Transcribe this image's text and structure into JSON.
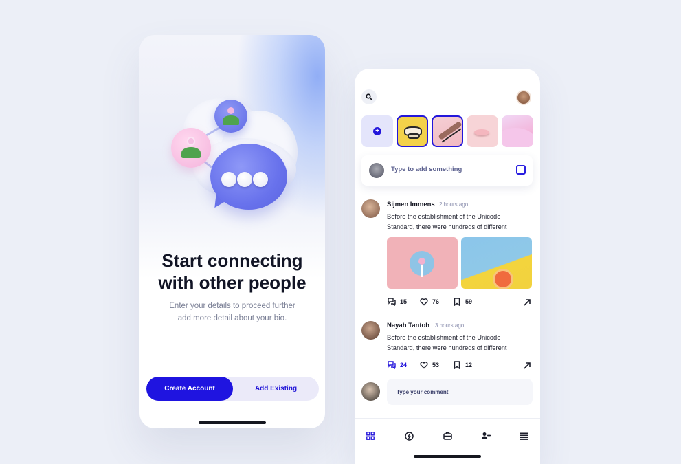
{
  "onboarding": {
    "headline_line1": "Start connecting",
    "headline_line2": "with other people",
    "sub_line1": "Enter your details to proceed further",
    "sub_line2": "add more detail about your bio.",
    "create_label": "Create Account",
    "existing_label": "Add Existing"
  },
  "feed": {
    "composer_placeholder": "Type to add something",
    "posts": [
      {
        "name": "Sijmen Immens",
        "time": "2 hours ago",
        "body_line1": "Before the establishment of the Unicode",
        "body_line2": "Standard, there were hundreds of different",
        "comments": "15",
        "likes": "76",
        "saves": "59"
      },
      {
        "name": "Nayah Tantoh",
        "time": "3 hours ago",
        "body_line1": "Before the establishment of the Unicode",
        "body_line2": "Standard, there were hundreds of different",
        "comments": "24",
        "likes": "53",
        "saves": "12"
      }
    ],
    "comment_placeholder": "Type your comment"
  },
  "colors": {
    "accent": "#1f14e0",
    "background": "#eceff7",
    "chat_bubble": "#6872ec"
  },
  "icons": [
    "search-icon",
    "plus-icon",
    "scan-icon",
    "comment-icon",
    "heart-icon",
    "bookmark-icon",
    "share-arrow-icon",
    "grid-icon",
    "compass-icon",
    "toolbox-icon",
    "add-user-icon",
    "menu-icon"
  ]
}
